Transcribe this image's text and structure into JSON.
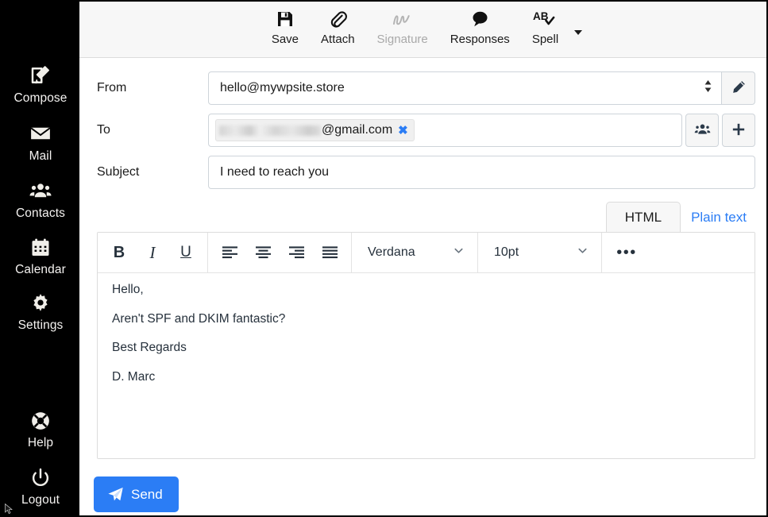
{
  "sidebar": {
    "items": [
      {
        "label": "Compose",
        "icon": "compose-icon"
      },
      {
        "label": "Mail",
        "icon": "mail-icon"
      },
      {
        "label": "Contacts",
        "icon": "contacts-icon"
      },
      {
        "label": "Calendar",
        "icon": "calendar-icon"
      },
      {
        "label": "Settings",
        "icon": "settings-icon"
      }
    ],
    "bottom_items": [
      {
        "label": "Help",
        "icon": "lifebuoy-icon"
      },
      {
        "label": "Logout",
        "icon": "power-icon"
      }
    ]
  },
  "toolbar": {
    "buttons": [
      {
        "label": "Save",
        "icon": "floppy-disk-icon",
        "disabled": false
      },
      {
        "label": "Attach",
        "icon": "paperclip-icon",
        "disabled": false
      },
      {
        "label": "Signature",
        "icon": "signature-scribble-icon",
        "disabled": true
      },
      {
        "label": "Responses",
        "icon": "speech-bubble-icon",
        "disabled": false
      },
      {
        "label": "Spell",
        "icon": "spellcheck-ab-icon",
        "disabled": false
      }
    ],
    "more_icon": "caret-down-icon"
  },
  "compose": {
    "from": {
      "label": "From",
      "value": "hello@mywpsite.store",
      "placeholder": "",
      "spinner_icon": "up-down-spinner-icon",
      "edit_icon": "pencil-icon"
    },
    "to": {
      "label": "To",
      "chip_text": "@gmail.com",
      "chip_redacted": true,
      "chip_close_icon": "close-x-icon",
      "contacts_icon": "people-icon",
      "add_icon": "plus-icon"
    },
    "subject": {
      "label": "Subject",
      "value": "I need to reach you",
      "placeholder": ""
    }
  },
  "editor": {
    "tabs": [
      {
        "label": "HTML",
        "active": true
      },
      {
        "label": "Plain text",
        "active": false
      }
    ],
    "format_buttons": [
      {
        "label": "B",
        "name": "bold",
        "icon": "bold-icon"
      },
      {
        "label": "I",
        "name": "italic",
        "icon": "italic-icon"
      },
      {
        "label": "U",
        "name": "underline",
        "icon": "underline-icon"
      }
    ],
    "align_buttons": [
      {
        "name": "align-left",
        "icon": "align-left-icon"
      },
      {
        "name": "align-center",
        "icon": "align-center-icon"
      },
      {
        "name": "align-right",
        "icon": "align-right-icon"
      },
      {
        "name": "align-justify",
        "icon": "align-justify-icon"
      }
    ],
    "font_family": "Verdana",
    "font_size": "10pt",
    "more_label": "•••",
    "body_lines": [
      "Hello,",
      "Aren't SPF and DKIM fantastic?",
      "Best Regards",
      "D. Marc"
    ]
  },
  "actions": {
    "send_label": "Send",
    "send_icon": "paper-plane-icon",
    "send_color": "#2b7df5"
  },
  "colors": {
    "sidebar_bg": "#000000",
    "toolbar_bg": "#f7f7f7",
    "accent": "#2b7df5",
    "text": "#1b1b1b",
    "muted": "#a9a9a9",
    "border": "#ced4da"
  }
}
